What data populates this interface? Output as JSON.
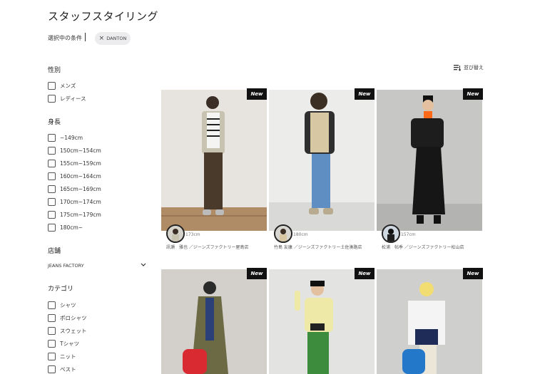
{
  "page": {
    "title": "スタッフスタイリング"
  },
  "conditions": {
    "label": "選択中の条件",
    "chip": "DANTON"
  },
  "sort": {
    "label": "並び替え"
  },
  "filters": {
    "gender": {
      "title": "性別",
      "options": [
        "メンズ",
        "レディース"
      ]
    },
    "height": {
      "title": "身長",
      "options": [
        "~149cm",
        "150cm~154cm",
        "155cm~159cm",
        "160cm~164cm",
        "165cm~169cm",
        "170cm~174cm",
        "175cm~179cm",
        "180cm~"
      ]
    },
    "store": {
      "title": "店舗",
      "value": "JEANS FACTORY"
    },
    "category": {
      "title": "カテゴリ",
      "options": [
        "シャツ",
        "ポロシャツ",
        "スウェット",
        "Tシャツ",
        "ニット",
        "ベスト"
      ]
    }
  },
  "cards": [
    {
      "badge": "New",
      "height": "173cm",
      "caption": "訊瀬　雅也 ／ジーンズファクトリー屋島店"
    },
    {
      "badge": "New",
      "height": "180cm",
      "caption": "竹島 友康 ／ジーンズファクトリー土佐湊路店"
    },
    {
      "badge": "New",
      "height": "157cm",
      "caption": "松浦　帖季 ／ジーンズファクトリー松山店"
    },
    {
      "badge": "New"
    },
    {
      "badge": "New"
    },
    {
      "badge": "New"
    }
  ],
  "colors": {
    "accent": "#111111",
    "chip_bg": "#ececee"
  }
}
